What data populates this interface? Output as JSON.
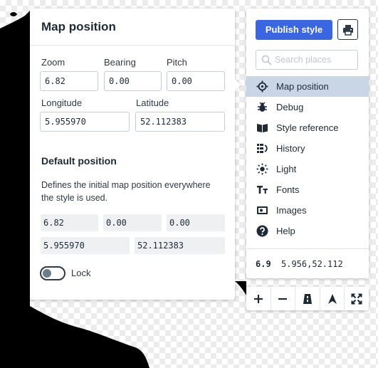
{
  "popover": {
    "title": "Map position",
    "zoom": {
      "label": "Zoom",
      "value": "6.82"
    },
    "bearing": {
      "label": "Bearing",
      "value": "0.00"
    },
    "pitch": {
      "label": "Pitch",
      "value": "0.00"
    },
    "longitude": {
      "label": "Longitude",
      "value": "5.955970"
    },
    "latitude": {
      "label": "Latitude",
      "value": "52.112383"
    },
    "default_position": {
      "title": "Default position",
      "description": "Defines the initial map position everywhere the style is used.",
      "zoom": "6.82",
      "bearing": "0.00",
      "pitch": "0.00",
      "longitude": "5.955970",
      "latitude": "52.112383",
      "lock_label": "Lock",
      "lock_enabled": false
    }
  },
  "toolbar": {
    "publish_label": "Publish style",
    "print_icon": "printer-icon",
    "search_placeholder": "Search places",
    "nav_items": [
      {
        "label": "Map position",
        "icon": "crosshair-icon",
        "active": true
      },
      {
        "label": "Debug",
        "icon": "bug-icon",
        "active": false
      },
      {
        "label": "Style reference",
        "icon": "book-icon",
        "active": false
      },
      {
        "label": "History",
        "icon": "history-icon",
        "active": false
      },
      {
        "label": "Light",
        "icon": "sun-icon",
        "active": false
      },
      {
        "label": "Fonts",
        "icon": "font-icon",
        "active": false
      },
      {
        "label": "Images",
        "icon": "image-icon",
        "active": false
      },
      {
        "label": "Help",
        "icon": "help-icon",
        "active": false
      }
    ],
    "active_color": "#c8d6e5",
    "accent_color": "#3b66e2"
  },
  "coords": {
    "zoom": "6.9",
    "lnglat": "5.956,52.112"
  },
  "map_controls": [
    "zoom-in-icon",
    "zoom-out-icon",
    "bearing-icon",
    "north-arrow-icon",
    "fullscreen-icon"
  ]
}
